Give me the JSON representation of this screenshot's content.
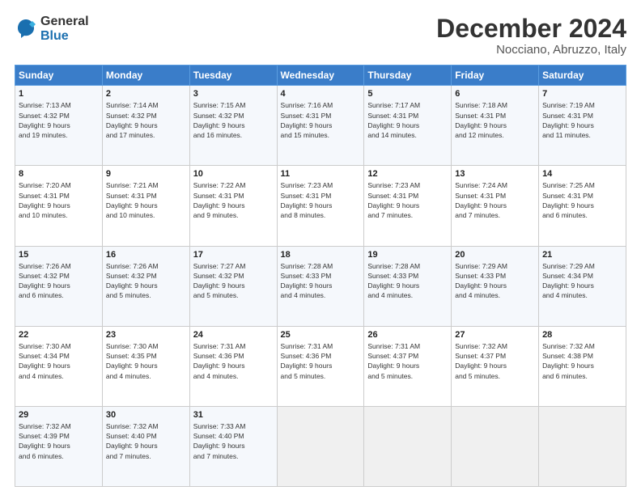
{
  "logo": {
    "general": "General",
    "blue": "Blue"
  },
  "title": "December 2024",
  "subtitle": "Nocciano, Abruzzo, Italy",
  "headers": [
    "Sunday",
    "Monday",
    "Tuesday",
    "Wednesday",
    "Thursday",
    "Friday",
    "Saturday"
  ],
  "rows": [
    [
      {
        "day": "1",
        "info": "Sunrise: 7:13 AM\nSunset: 4:32 PM\nDaylight: 9 hours\nand 19 minutes."
      },
      {
        "day": "2",
        "info": "Sunrise: 7:14 AM\nSunset: 4:32 PM\nDaylight: 9 hours\nand 17 minutes."
      },
      {
        "day": "3",
        "info": "Sunrise: 7:15 AM\nSunset: 4:32 PM\nDaylight: 9 hours\nand 16 minutes."
      },
      {
        "day": "4",
        "info": "Sunrise: 7:16 AM\nSunset: 4:31 PM\nDaylight: 9 hours\nand 15 minutes."
      },
      {
        "day": "5",
        "info": "Sunrise: 7:17 AM\nSunset: 4:31 PM\nDaylight: 9 hours\nand 14 minutes."
      },
      {
        "day": "6",
        "info": "Sunrise: 7:18 AM\nSunset: 4:31 PM\nDaylight: 9 hours\nand 12 minutes."
      },
      {
        "day": "7",
        "info": "Sunrise: 7:19 AM\nSunset: 4:31 PM\nDaylight: 9 hours\nand 11 minutes."
      }
    ],
    [
      {
        "day": "8",
        "info": "Sunrise: 7:20 AM\nSunset: 4:31 PM\nDaylight: 9 hours\nand 10 minutes."
      },
      {
        "day": "9",
        "info": "Sunrise: 7:21 AM\nSunset: 4:31 PM\nDaylight: 9 hours\nand 10 minutes."
      },
      {
        "day": "10",
        "info": "Sunrise: 7:22 AM\nSunset: 4:31 PM\nDaylight: 9 hours\nand 9 minutes."
      },
      {
        "day": "11",
        "info": "Sunrise: 7:23 AM\nSunset: 4:31 PM\nDaylight: 9 hours\nand 8 minutes."
      },
      {
        "day": "12",
        "info": "Sunrise: 7:23 AM\nSunset: 4:31 PM\nDaylight: 9 hours\nand 7 minutes."
      },
      {
        "day": "13",
        "info": "Sunrise: 7:24 AM\nSunset: 4:31 PM\nDaylight: 9 hours\nand 7 minutes."
      },
      {
        "day": "14",
        "info": "Sunrise: 7:25 AM\nSunset: 4:31 PM\nDaylight: 9 hours\nand 6 minutes."
      }
    ],
    [
      {
        "day": "15",
        "info": "Sunrise: 7:26 AM\nSunset: 4:32 PM\nDaylight: 9 hours\nand 6 minutes."
      },
      {
        "day": "16",
        "info": "Sunrise: 7:26 AM\nSunset: 4:32 PM\nDaylight: 9 hours\nand 5 minutes."
      },
      {
        "day": "17",
        "info": "Sunrise: 7:27 AM\nSunset: 4:32 PM\nDaylight: 9 hours\nand 5 minutes."
      },
      {
        "day": "18",
        "info": "Sunrise: 7:28 AM\nSunset: 4:33 PM\nDaylight: 9 hours\nand 4 minutes."
      },
      {
        "day": "19",
        "info": "Sunrise: 7:28 AM\nSunset: 4:33 PM\nDaylight: 9 hours\nand 4 minutes."
      },
      {
        "day": "20",
        "info": "Sunrise: 7:29 AM\nSunset: 4:33 PM\nDaylight: 9 hours\nand 4 minutes."
      },
      {
        "day": "21",
        "info": "Sunrise: 7:29 AM\nSunset: 4:34 PM\nDaylight: 9 hours\nand 4 minutes."
      }
    ],
    [
      {
        "day": "22",
        "info": "Sunrise: 7:30 AM\nSunset: 4:34 PM\nDaylight: 9 hours\nand 4 minutes."
      },
      {
        "day": "23",
        "info": "Sunrise: 7:30 AM\nSunset: 4:35 PM\nDaylight: 9 hours\nand 4 minutes."
      },
      {
        "day": "24",
        "info": "Sunrise: 7:31 AM\nSunset: 4:36 PM\nDaylight: 9 hours\nand 4 minutes."
      },
      {
        "day": "25",
        "info": "Sunrise: 7:31 AM\nSunset: 4:36 PM\nDaylight: 9 hours\nand 5 minutes."
      },
      {
        "day": "26",
        "info": "Sunrise: 7:31 AM\nSunset: 4:37 PM\nDaylight: 9 hours\nand 5 minutes."
      },
      {
        "day": "27",
        "info": "Sunrise: 7:32 AM\nSunset: 4:37 PM\nDaylight: 9 hours\nand 5 minutes."
      },
      {
        "day": "28",
        "info": "Sunrise: 7:32 AM\nSunset: 4:38 PM\nDaylight: 9 hours\nand 6 minutes."
      }
    ],
    [
      {
        "day": "29",
        "info": "Sunrise: 7:32 AM\nSunset: 4:39 PM\nDaylight: 9 hours\nand 6 minutes."
      },
      {
        "day": "30",
        "info": "Sunrise: 7:32 AM\nSunset: 4:40 PM\nDaylight: 9 hours\nand 7 minutes."
      },
      {
        "day": "31",
        "info": "Sunrise: 7:33 AM\nSunset: 4:40 PM\nDaylight: 9 hours\nand 7 minutes."
      },
      null,
      null,
      null,
      null
    ]
  ]
}
